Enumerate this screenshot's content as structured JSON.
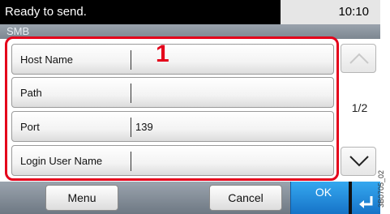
{
  "status": {
    "message": "Ready to send.",
    "time": "10:10"
  },
  "title": "SMB",
  "annotation": {
    "callout": "1",
    "image_code": "3B0705_02"
  },
  "fields": [
    {
      "label": "Host Name",
      "value": ""
    },
    {
      "label": "Path",
      "value": ""
    },
    {
      "label": "Port",
      "value": "139"
    },
    {
      "label": "Login User Name",
      "value": ""
    }
  ],
  "pagination": {
    "indicator": "1/2"
  },
  "bottom": {
    "menu_label": "Menu",
    "cancel_label": "Cancel",
    "ok_label": "OK"
  },
  "icons": {
    "scroll_up": "chevron-up-icon",
    "scroll_down": "chevron-down-icon",
    "enter": "enter-arrow-icon"
  },
  "colors": {
    "highlight": "#e4001b",
    "ok_button": "#1f87d8"
  }
}
